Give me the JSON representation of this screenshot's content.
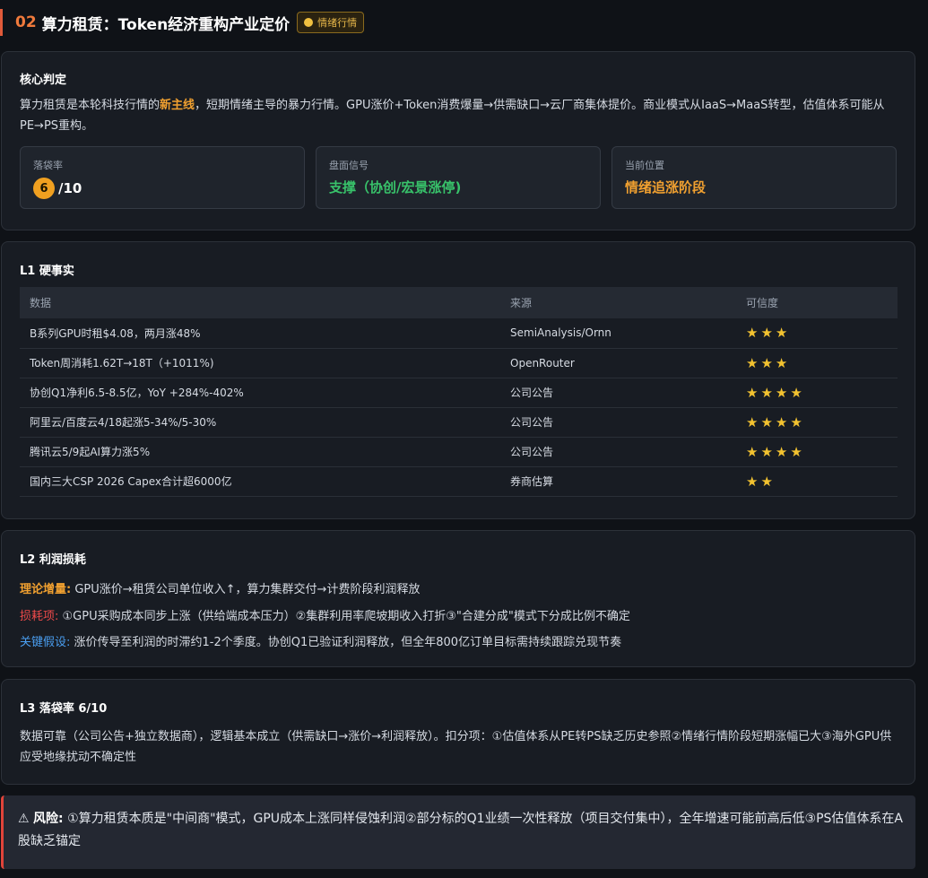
{
  "header": {
    "number": "02",
    "title": "算力租赁：Token经济重构产业定价",
    "badge": "情绪行情"
  },
  "core": {
    "heading": "核心判定",
    "lead_pre": "算力租赁是本轮科技行情的",
    "lead_highlight": "新主线",
    "lead_post": "，短期情绪主导的暴力行情。GPU涨价+Token消费爆量→供需缺口→云厂商集体提价。商业模式从IaaS→MaaS转型，估值体系可能从PE→PS重构。",
    "metrics": [
      {
        "label": "落袋率",
        "score": "6",
        "suffix": "/10"
      },
      {
        "label": "盘面信号",
        "value": "支撑（协创/宏景涨停)"
      },
      {
        "label": "当前位置",
        "value": "情绪追涨阶段"
      }
    ]
  },
  "facts": {
    "heading": "L1 硬事实",
    "columns": [
      "数据",
      "来源",
      "可信度"
    ],
    "rows": [
      {
        "data": "B系列GPU时租$4.08，两月涨48%",
        "source": "SemiAnalysis/Ornn",
        "stars": 3
      },
      {
        "data": "Token周消耗1.62T→18T（+1011%)",
        "source": "OpenRouter",
        "stars": 3
      },
      {
        "data": "协创Q1净利6.5-8.5亿，YoY +284%-402%",
        "source": "公司公告",
        "stars": 4
      },
      {
        "data": "阿里云/百度云4/18起涨5-34%/5-30%",
        "source": "公司公告",
        "stars": 4
      },
      {
        "data": "腾讯云5/9起AI算力涨5%",
        "source": "公司公告",
        "stars": 4
      },
      {
        "data": "国内三大CSP 2026 Capex合计超6000亿",
        "source": "券商估算",
        "stars": 2
      }
    ]
  },
  "profit": {
    "heading": "L2 利润损耗",
    "items": [
      {
        "tag": "理论增量:",
        "text": " GPU涨价→租赁公司单位收入↑，算力集群交付→计费阶段利润释放"
      },
      {
        "tag": "损耗项:",
        "text": " ①GPU采购成本同步上涨（供给端成本压力）②集群利用率爬坡期收入打折③\"合建分成\"模式下分成比例不确定"
      },
      {
        "tag": "关键假设:",
        "text": " 涨价传导至利润的时滞约1-2个季度。协创Q1已验证利润释放，但全年800亿订单目标需持续跟踪兑现节奏"
      }
    ]
  },
  "rate": {
    "heading": "L3 落袋率 6/10",
    "body": "数据可靠（公司公告+独立数据商），逻辑基本成立（供需缺口→涨价→利润释放）。扣分项：①估值体系从PE转PS缺乏历史参照②情绪行情阶段短期涨幅已大③海外GPU供应受地缘扰动不确定性"
  },
  "risk": {
    "icon": "⚠",
    "label": "风险:",
    "text": " ①算力租赁本质是\"中间商\"模式，GPU成本上涨同样侵蚀利润②部分标的Q1业绩一次性释放（项目交付集中），全年增速可能前高后低③PS估值体系在A股缺乏锚定"
  },
  "colors": {
    "accent_orange": "#f0a030",
    "signal_green": "#38c26a",
    "risk_red": "#e0443a",
    "star_gold": "#f2c230"
  }
}
